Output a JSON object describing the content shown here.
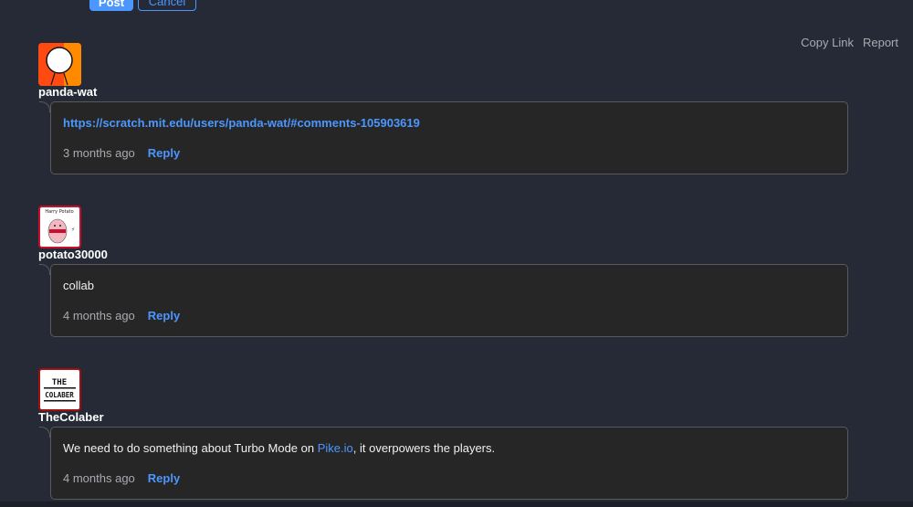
{
  "composer": {
    "post_label": "Post",
    "cancel_label": "Cancel"
  },
  "actions": {
    "copy_link": "Copy Link",
    "report": "Report"
  },
  "comments": [
    {
      "username": "panda-wat",
      "text": "https://scratch.mit.edu/users/panda-wat/#comments-105903619",
      "time": "3 months ago",
      "reply": "Reply"
    },
    {
      "username": "potato30000",
      "text": "collab",
      "time": "4 months ago",
      "reply": "Reply",
      "avatar_text": "Harry Potato"
    },
    {
      "username": "TheColaber",
      "text_before": "We need to do something about Turbo Mode on ",
      "link": "Pike.io",
      "text_after": ", it overpowers the players.",
      "time": "4 months ago",
      "reply": "Reply",
      "avatar_text": "THE COLABER"
    }
  ]
}
